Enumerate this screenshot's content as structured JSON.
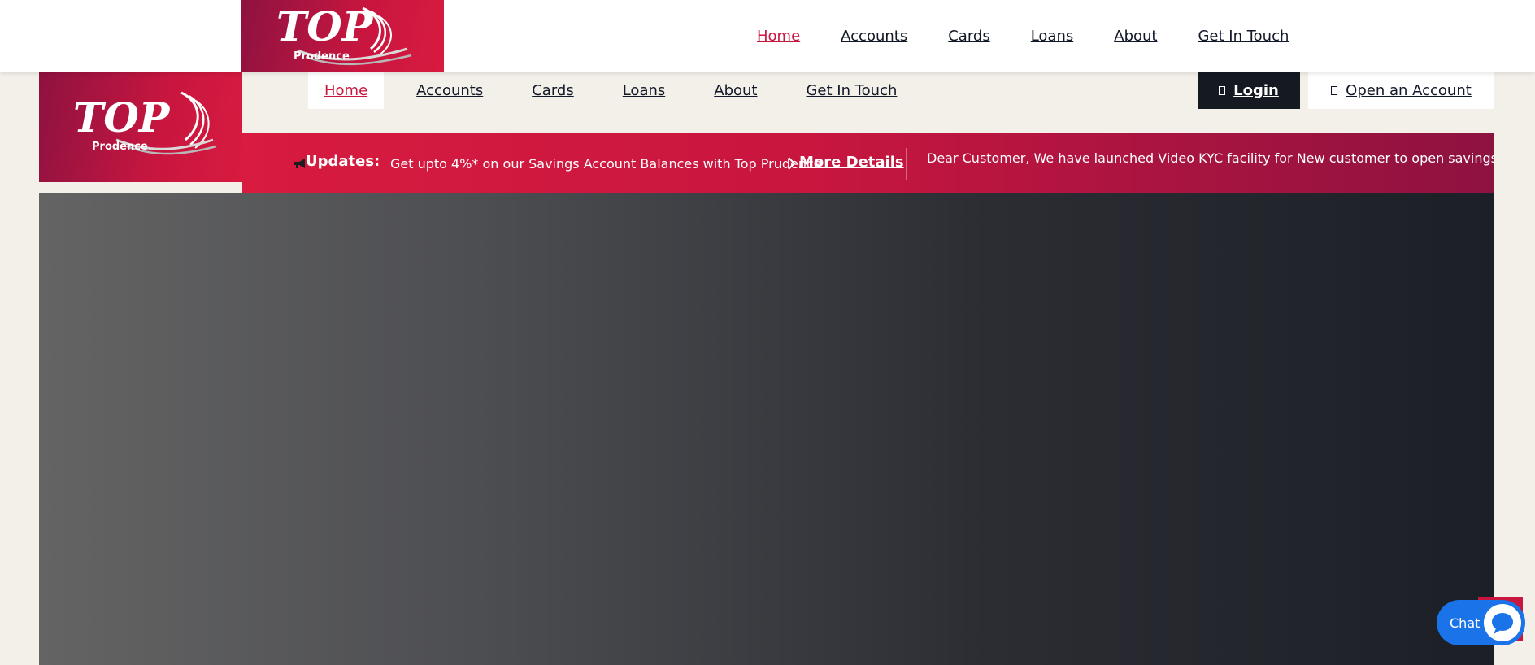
{
  "brand": {
    "logo_word": "TOP",
    "logo_sub": "Prodence",
    "primary_color": "#c8163f",
    "dark_color": "#8e1240"
  },
  "top_nav": {
    "items": [
      {
        "label": "Home",
        "active": true
      },
      {
        "label": "Accounts"
      },
      {
        "label": "Cards"
      },
      {
        "label": "Loans"
      },
      {
        "label": "About"
      },
      {
        "label": "Get In Touch"
      }
    ]
  },
  "sub_nav": {
    "items": [
      {
        "label": "Home",
        "active": true
      },
      {
        "label": "Accounts"
      },
      {
        "label": "Cards"
      },
      {
        "label": "Loans"
      },
      {
        "label": "About"
      },
      {
        "label": "Get In Touch"
      }
    ]
  },
  "actions": {
    "login_label": "Login",
    "open_account_label": "Open an Account"
  },
  "updates": {
    "label": "Updates:",
    "text_1": "Get upto 4%* on our Savings Account Balances with Top Prudence .",
    "more_details_label": "More Details",
    "text_2": "Dear Customer, We have launched Video KYC facility for New customer to open savings ac"
  },
  "chat": {
    "label": "Chat",
    "color": "#1a73e8"
  }
}
